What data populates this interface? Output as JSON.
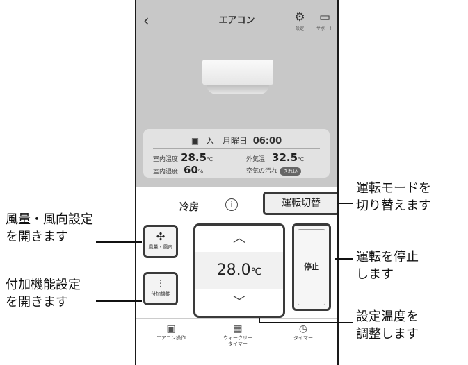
{
  "header": {
    "title": "エアコン",
    "back_icon": "‹",
    "settings_label": "設定",
    "support_label": "サポート"
  },
  "status": {
    "timer_label": "入",
    "day": "月曜日",
    "time": "06:00",
    "indoor_temp_label": "室内温度",
    "indoor_temp_value": "28.5",
    "indoor_temp_unit": "℃",
    "outdoor_temp_label": "外気温",
    "outdoor_temp_value": "32.5",
    "outdoor_temp_unit": "℃",
    "indoor_humidity_label": "室内湿度",
    "indoor_humidity_value": "60",
    "indoor_humidity_unit": "%",
    "air_quality_label": "空気の汚れ",
    "air_quality_value": "きれい"
  },
  "controls": {
    "mode": "冷房",
    "switch_mode_label": "運転切替",
    "fan_label": "風量・風向",
    "extra_label": "付加機能",
    "temperature_value": "28.0",
    "temperature_unit": "℃",
    "stop_label": "停止"
  },
  "tabs": [
    {
      "label": "エアコン操作"
    },
    {
      "label": "ウィークリー",
      "label2": "タイマー"
    },
    {
      "label": "タイマー"
    }
  ],
  "callouts": {
    "switch_mode_1": "運転モードを",
    "switch_mode_2": "切り替えます",
    "fan_1": "風量・風向設定",
    "fan_2": "を開きます",
    "stop_1": "運転を停止",
    "stop_2": "します",
    "extra_1": "付加機能設定",
    "extra_2": "を開きます",
    "temp_1": "設定温度を",
    "temp_2": "調整します"
  }
}
